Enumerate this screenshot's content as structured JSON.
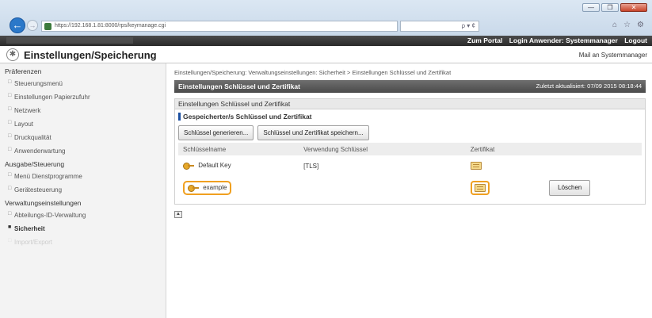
{
  "browser": {
    "url": "https://192.168.1.81:8000/rps/keymanage.cgi",
    "search_placeholder": "ρ ▾ ¢",
    "window_buttons": [
      "—",
      "❐",
      "✕"
    ]
  },
  "portal": {
    "links": [
      "Zum Portal",
      "Login Anwender: Systemmanager",
      "Logout"
    ]
  },
  "page": {
    "title": "Einstellungen/Speicherung",
    "mail_link": "Mail an Systemmanager"
  },
  "sidebar": {
    "groups": [
      {
        "heading": "Präferenzen",
        "items": [
          "Steuerungsmenü",
          "Einstellungen Papierzufuhr",
          "Netzwerk",
          "Layout",
          "Druckqualität",
          "Anwenderwartung"
        ]
      },
      {
        "heading": "Ausgabe/Steuerung",
        "items": [
          "Menü Dienstprogramme",
          "Gerätesteuerung"
        ]
      },
      {
        "heading": "Verwaltungseinstellungen",
        "items": [
          "Abteilungs-ID-Verwaltung",
          "Sicherheit",
          "Import/Export"
        ]
      }
    ]
  },
  "main": {
    "breadcrumb": "Einstellungen/Speicherung: Verwaltungseinstellungen: Sicherheit > Einstellungen Schlüssel und Zertifikat",
    "header_title": "Einstellungen Schlüssel und Zertifikat",
    "last_updated": "Zuletzt aktualisiert: 07/09 2015 08:18:44",
    "subheader": "Einstellungen Schlüssel und Zertifikat",
    "section_title": "Gespeicherter/s Schlüssel und Zertifikat",
    "buttons": {
      "generate": "Schlüssel generieren...",
      "save": "Schlüssel und Zertifikat speichern..."
    },
    "table": {
      "columns": [
        "Schlüsselname",
        "Verwendung Schlüssel",
        "Zertifikat",
        ""
      ],
      "rows": [
        {
          "name": "Default Key",
          "usage": "[TLS]",
          "delete": ""
        },
        {
          "name": "example",
          "usage": "",
          "delete": "Löschen"
        }
      ]
    }
  }
}
